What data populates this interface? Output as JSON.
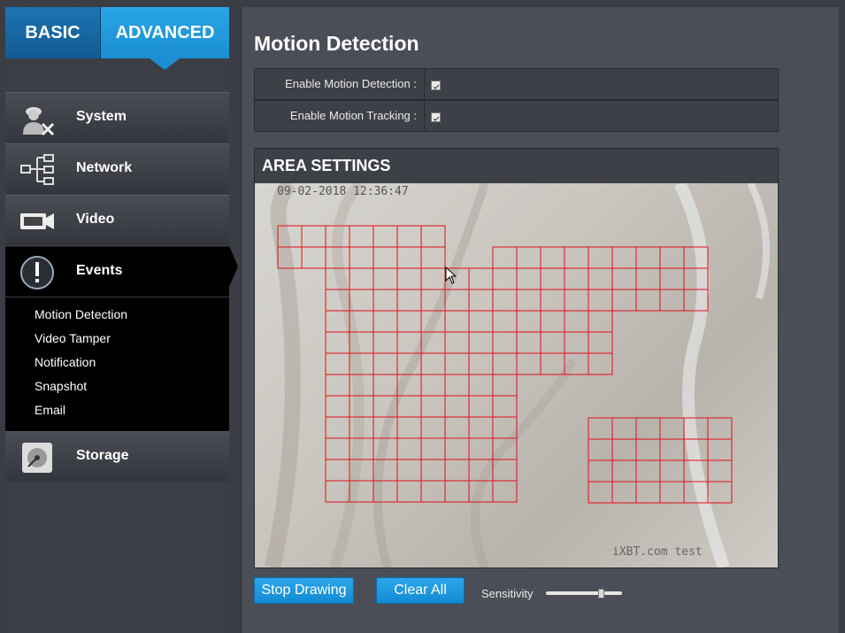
{
  "mode_tabs": {
    "basic": "BASIC",
    "advanced": "ADVANCED"
  },
  "nav": {
    "system": "System",
    "network": "Network",
    "video": "Video",
    "events": "Events",
    "storage": "Storage",
    "events_sub": [
      "Motion Detection",
      "Video Tamper",
      "Notification",
      "Snapshot",
      "Email"
    ]
  },
  "page": {
    "title": "Motion Detection",
    "enable_motion_detection_label": "Enable Motion Detection :",
    "enable_motion_detection_checked": true,
    "enable_motion_tracking_label": "Enable Motion Tracking :",
    "enable_motion_tracking_checked": true,
    "area_title": "AREA SETTINGS",
    "timestamp": "09-02-2018 12:36:47",
    "watermark": "iXBT.com test",
    "stop_drawing": "Stop Drawing",
    "clear_all": "Clear All",
    "sensitivity_label": "Sensitivity",
    "sensitivity_level": 0.75
  },
  "colors": {
    "accent": "#1b8fd2",
    "grid_line": "#e0101a"
  },
  "icons": {
    "system": "system-admin-icon",
    "network": "network-topology-icon",
    "video": "video-camera-icon",
    "events": "alert-icon",
    "storage": "hard-disk-icon"
  }
}
